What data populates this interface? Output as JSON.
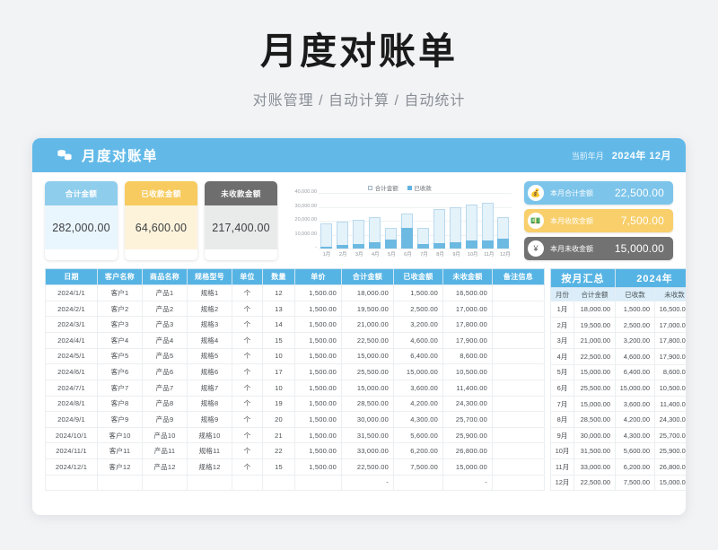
{
  "page": {
    "title": "月度对账单",
    "subtitle": "对账管理 / 自动计算 / 自动统计"
  },
  "sheet_header": {
    "icon": "coins-stack-icon",
    "title": "月度对账单",
    "current_period_label": "当前年月",
    "current_period_value": "2024年 12月"
  },
  "kpis": [
    {
      "label": "合计金额",
      "value": "282,000.00",
      "color": "#8fcdec"
    },
    {
      "label": "已收款金额",
      "value": "64,600.00",
      "color": "#f7cb5f"
    },
    {
      "label": "未收款金额",
      "value": "217,400.00",
      "color": "#6e6e6e"
    }
  ],
  "mini_cards": [
    {
      "icon": "money-bag-icon",
      "label": "本月合计金额",
      "value": "22,500.00",
      "color": "#7cc4ea"
    },
    {
      "icon": "cash-icon",
      "label": "本月收款金额",
      "value": "7,500.00",
      "color": "#f8cf6b"
    },
    {
      "icon": "yen-coin-icon",
      "label": "本月未收金额",
      "value": "15,000.00",
      "color": "#727272"
    }
  ],
  "chart_data": {
    "type": "bar",
    "title": "",
    "categories": [
      "1月",
      "2月",
      "3月",
      "4月",
      "5月",
      "6月",
      "7月",
      "8月",
      "9月",
      "10月",
      "11月",
      "12月"
    ],
    "series": [
      {
        "name": "合计金额",
        "values": [
          18000,
          19500,
          21000,
          22500,
          15000,
          25500,
          15000,
          28500,
          30000,
          31500,
          33000,
          22500
        ]
      },
      {
        "name": "已收款",
        "values": [
          1500,
          2500,
          3200,
          4600,
          6400,
          15000,
          3600,
          4200,
          4300,
          5600,
          6200,
          7500
        ]
      }
    ],
    "yticks": [
      "40,000.00",
      "30,000.00",
      "20,000.00",
      "10,000.00",
      "-"
    ],
    "ylim": [
      0,
      40000
    ],
    "grid": true,
    "legend_position": "top-center",
    "xlabel": "",
    "ylabel": ""
  },
  "main_table": {
    "headers": [
      "日期",
      "客户名称",
      "商品名称",
      "规格型号",
      "单位",
      "数量",
      "单价",
      "合计金额",
      "已收金额",
      "未收金额",
      "备注信息"
    ],
    "rows": [
      [
        "2024/1/1",
        "客户1",
        "产品1",
        "规格1",
        "个",
        "12",
        "1,500.00",
        "18,000.00",
        "1,500.00",
        "16,500.00",
        ""
      ],
      [
        "2024/2/1",
        "客户2",
        "产品2",
        "规格2",
        "个",
        "13",
        "1,500.00",
        "19,500.00",
        "2,500.00",
        "17,000.00",
        ""
      ],
      [
        "2024/3/1",
        "客户3",
        "产品3",
        "规格3",
        "个",
        "14",
        "1,500.00",
        "21,000.00",
        "3,200.00",
        "17,800.00",
        ""
      ],
      [
        "2024/4/1",
        "客户4",
        "产品4",
        "规格4",
        "个",
        "15",
        "1,500.00",
        "22,500.00",
        "4,600.00",
        "17,900.00",
        ""
      ],
      [
        "2024/5/1",
        "客户5",
        "产品5",
        "规格5",
        "个",
        "10",
        "1,500.00",
        "15,000.00",
        "6,400.00",
        "8,600.00",
        ""
      ],
      [
        "2024/6/1",
        "客户6",
        "产品6",
        "规格6",
        "个",
        "17",
        "1,500.00",
        "25,500.00",
        "15,000.00",
        "10,500.00",
        ""
      ],
      [
        "2024/7/1",
        "客户7",
        "产品7",
        "规格7",
        "个",
        "10",
        "1,500.00",
        "15,000.00",
        "3,600.00",
        "11,400.00",
        ""
      ],
      [
        "2024/8/1",
        "客户8",
        "产品8",
        "规格8",
        "个",
        "19",
        "1,500.00",
        "28,500.00",
        "4,200.00",
        "24,300.00",
        ""
      ],
      [
        "2024/9/1",
        "客户9",
        "产品9",
        "规格9",
        "个",
        "20",
        "1,500.00",
        "30,000.00",
        "4,300.00",
        "25,700.00",
        ""
      ],
      [
        "2024/10/1",
        "客户10",
        "产品10",
        "规格10",
        "个",
        "21",
        "1,500.00",
        "31,500.00",
        "5,600.00",
        "25,900.00",
        ""
      ],
      [
        "2024/11/1",
        "客户11",
        "产品11",
        "规格11",
        "个",
        "22",
        "1,500.00",
        "33,000.00",
        "6,200.00",
        "26,800.00",
        ""
      ],
      [
        "2024/12/1",
        "客户12",
        "产品12",
        "规格12",
        "个",
        "15",
        "1,500.00",
        "22,500.00",
        "7,500.00",
        "15,000.00",
        ""
      ],
      [
        "",
        "",
        "",
        "",
        "",
        "",
        "",
        "-",
        "",
        "-",
        ""
      ]
    ]
  },
  "summary_table": {
    "title": "按月汇总",
    "year": "2024年",
    "headers": [
      "月份",
      "合计金额",
      "已收款",
      "未收款"
    ],
    "rows": [
      [
        "1月",
        "18,000.00",
        "1,500.00",
        "16,500.00"
      ],
      [
        "2月",
        "19,500.00",
        "2,500.00",
        "17,000.00"
      ],
      [
        "3月",
        "21,000.00",
        "3,200.00",
        "17,800.00"
      ],
      [
        "4月",
        "22,500.00",
        "4,600.00",
        "17,900.00"
      ],
      [
        "5月",
        "15,000.00",
        "6,400.00",
        "8,600.00"
      ],
      [
        "6月",
        "25,500.00",
        "15,000.00",
        "10,500.00"
      ],
      [
        "7月",
        "15,000.00",
        "3,600.00",
        "11,400.00"
      ],
      [
        "8月",
        "28,500.00",
        "4,200.00",
        "24,300.00"
      ],
      [
        "9月",
        "30,000.00",
        "4,300.00",
        "25,700.00"
      ],
      [
        "10月",
        "31,500.00",
        "5,600.00",
        "25,900.00"
      ],
      [
        "11月",
        "33,000.00",
        "6,200.00",
        "26,800.00"
      ],
      [
        "12月",
        "22,500.00",
        "7,500.00",
        "15,000.00"
      ]
    ]
  }
}
